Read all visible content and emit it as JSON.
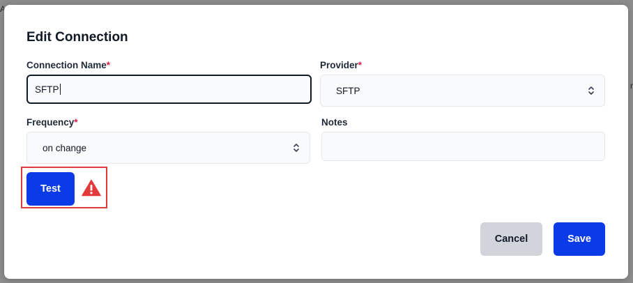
{
  "backdrop": {
    "left_fragment": "A",
    "right_fragment": "r"
  },
  "dialog": {
    "title": "Edit Connection",
    "required_marker": "*",
    "fields": {
      "connection_name": {
        "label": "Connection Name",
        "value": "SFTP",
        "required": true
      },
      "provider": {
        "label": "Provider",
        "value": "SFTP",
        "required": true
      },
      "frequency": {
        "label": "Frequency",
        "value": "on change",
        "required": true
      },
      "notes": {
        "label": "Notes",
        "value": "",
        "required": false
      }
    },
    "test_button_label": "Test",
    "status_icon": "warning-triangle-icon",
    "cancel_label": "Cancel",
    "save_label": "Save"
  },
  "colors": {
    "primary": "#0b3be6",
    "secondary": "#d1d5db",
    "required": "#e11d48",
    "warning": "#e23b3b",
    "highlight_box": "#e23b3b"
  }
}
